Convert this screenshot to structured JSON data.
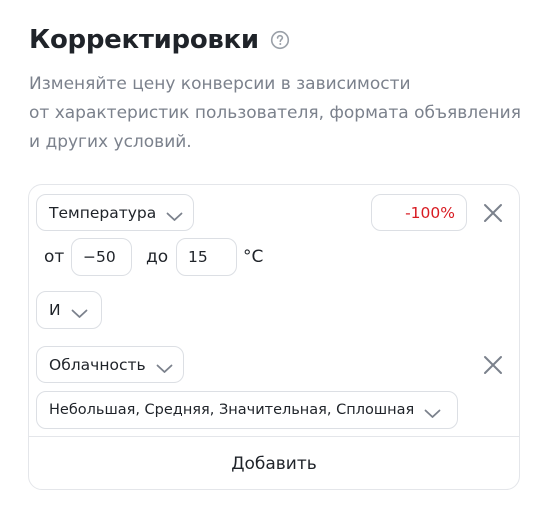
{
  "header": {
    "title": "Корректировки",
    "description_lines": [
      "Изменяйте цену конверсии в зависимости",
      "от характеристик пользователя, формата объявления",
      "и других условий."
    ]
  },
  "conditions": {
    "temperature": {
      "selector_label": "Температура",
      "adjustment": "-100%",
      "from_label": "от",
      "from_value": "−50",
      "to_label": "до",
      "to_value": "15",
      "unit": "°C"
    },
    "operator": "И",
    "cloudiness": {
      "selector_label": "Облачность",
      "values": "Небольшая, Средняя, Значительная, Сплошная"
    }
  },
  "footer": {
    "add_label": "Добавить"
  },
  "colors": {
    "accent_negative": "#d81b22",
    "muted_text": "#7b818c",
    "border": "#dcdfe4"
  }
}
